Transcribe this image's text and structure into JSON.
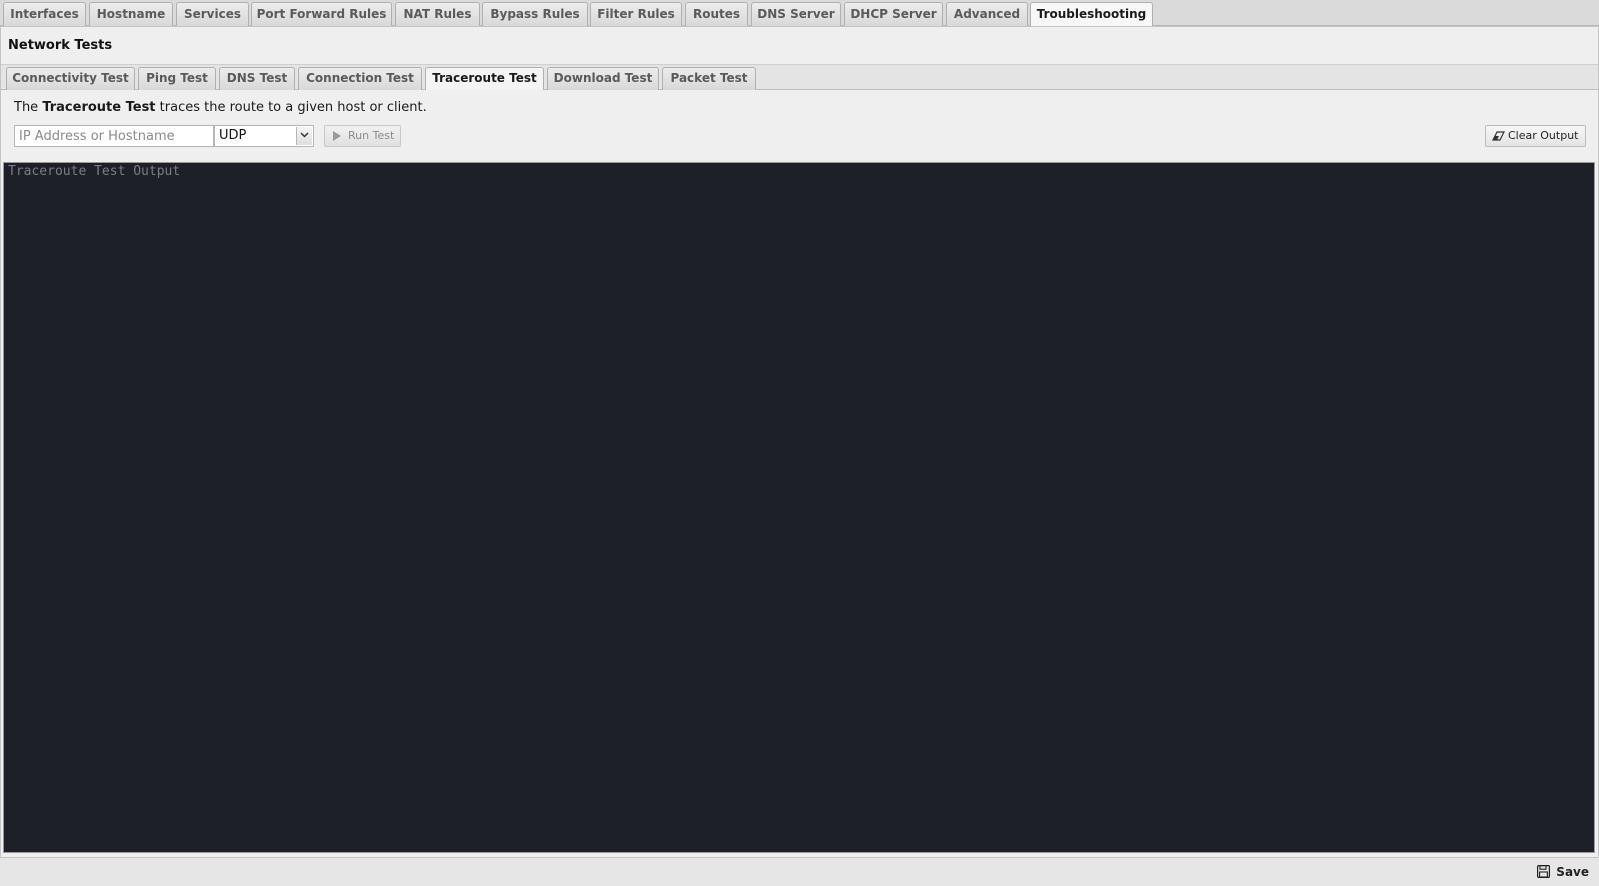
{
  "top_tabs": [
    {
      "label": "Interfaces",
      "active": false
    },
    {
      "label": "Hostname",
      "active": false
    },
    {
      "label": "Services",
      "active": false
    },
    {
      "label": "Port Forward Rules",
      "active": false
    },
    {
      "label": "NAT Rules",
      "active": false
    },
    {
      "label": "Bypass Rules",
      "active": false
    },
    {
      "label": "Filter Rules",
      "active": false
    },
    {
      "label": "Routes",
      "active": false
    },
    {
      "label": "DNS Server",
      "active": false
    },
    {
      "label": "DHCP Server",
      "active": false
    },
    {
      "label": "Advanced",
      "active": false
    },
    {
      "label": "Troubleshooting",
      "active": true
    }
  ],
  "panel": {
    "title": "Network Tests"
  },
  "sub_tabs": [
    {
      "label": "Connectivity Test",
      "active": false
    },
    {
      "label": "Ping Test",
      "active": false
    },
    {
      "label": "DNS Test",
      "active": false
    },
    {
      "label": "Connection Test",
      "active": false
    },
    {
      "label": "Traceroute Test",
      "active": true
    },
    {
      "label": "Download Test",
      "active": false
    },
    {
      "label": "Packet Test",
      "active": false
    }
  ],
  "traceroute": {
    "description_prefix": "The ",
    "description_bold": "Traceroute Test",
    "description_suffix": " traces the route to a given host or client.",
    "host_input": {
      "value": "",
      "placeholder": "IP Address or Hostname"
    },
    "protocol_select": {
      "selected": "UDP"
    },
    "run_button_label": "Run Test",
    "run_button_enabled": false,
    "clear_button_label": "Clear Output",
    "output_placeholder": "Traceroute Test Output"
  },
  "footer": {
    "save_label": "Save"
  },
  "colors": {
    "output_background": "#1d2029",
    "output_placeholder_text": "#7a7d86",
    "tab_text": "#5a5a5a",
    "active_tab_text": "#1a1a1a"
  },
  "icons": {
    "run_button": "play-icon",
    "clear_button": "eraser-icon",
    "save_button": "floppy-disk-icon",
    "select_arrow": "chevron-down-icon"
  }
}
